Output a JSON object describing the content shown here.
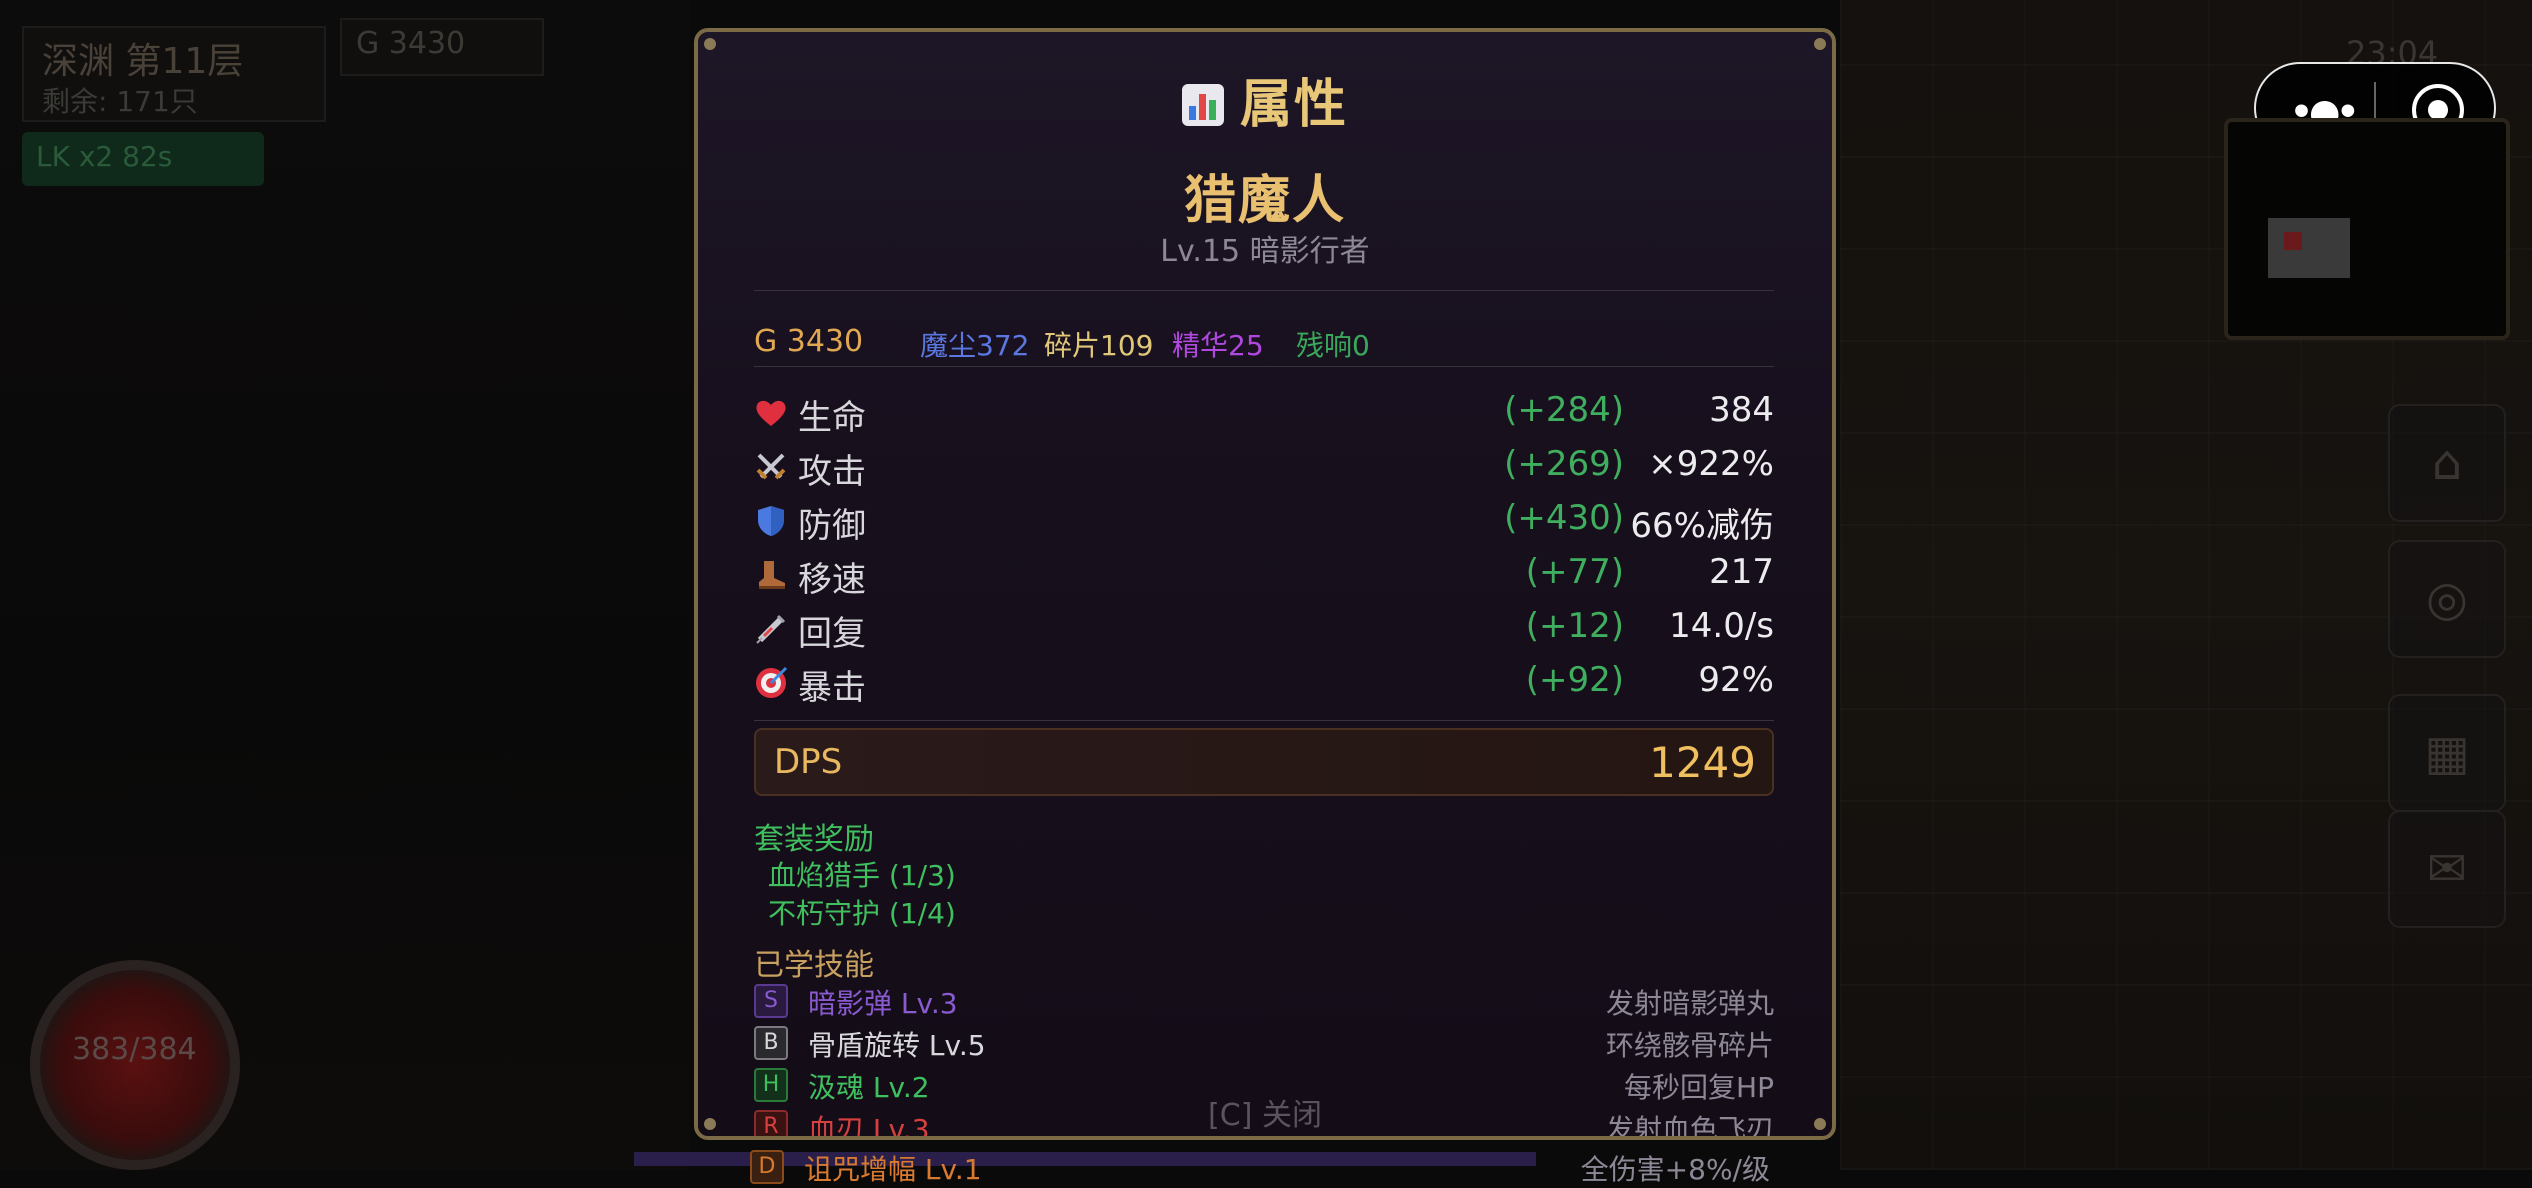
{
  "hud": {
    "floor": "深渊 第11层",
    "remaining": "剩余: 171只",
    "gold": "G 3430",
    "buff": "LK x2 82s",
    "hp_orb": "383/384",
    "clock": "23:04"
  },
  "miniprogram": {
    "menu_icon": "more-dots-icon",
    "close_icon": "target-close-icon"
  },
  "side_buttons": [
    "home-icon",
    "globe-icon",
    "shop-icon",
    "mail-icon"
  ],
  "panel": {
    "title": "属性",
    "title_icon": "bar-chart-icon",
    "character_name": "猎魔人",
    "character_sub": "Lv.15 暗影行者",
    "currencies": [
      {
        "label": "G 3430",
        "color": "#e0a850"
      },
      {
        "label": "魔尘372",
        "color": "#5a78e0"
      },
      {
        "label": "碎片109",
        "color": "#e0c878"
      },
      {
        "label": "精华25",
        "color": "#b048e0"
      },
      {
        "label": "残响0",
        "color": "#3aa85a"
      }
    ],
    "stats": [
      {
        "icon": "heart-icon",
        "label": "生命",
        "bonus": "(+284)",
        "value": "384"
      },
      {
        "icon": "crossed-swords-icon",
        "label": "攻击",
        "bonus": "(+269)",
        "value": "×922%"
      },
      {
        "icon": "shield-icon",
        "label": "防御",
        "bonus": "(+430)",
        "value": "66%减伤"
      },
      {
        "icon": "boot-icon",
        "label": "移速",
        "bonus": "(+77)",
        "value": "217"
      },
      {
        "icon": "syringe-icon",
        "label": "回复",
        "bonus": "(+12)",
        "value": "14.0/s"
      },
      {
        "icon": "target-icon",
        "label": "暴击",
        "bonus": "(+92)",
        "value": "92%"
      }
    ],
    "dps_label": "DPS",
    "dps_value": "1249",
    "set_title": "套装奖励",
    "sets": [
      "血焰猎手 (1/3)",
      "不朽守护 (1/4)"
    ],
    "skills_title": "已学技能",
    "skills": [
      {
        "badge": "S",
        "name": "暗影弹 Lv.3",
        "desc": "发射暗影弹丸",
        "color": "#8a5ad0"
      },
      {
        "badge": "B",
        "name": "骨盾旋转 Lv.5",
        "desc": "环绕骸骨碎片",
        "color": "#d8d8dc"
      },
      {
        "badge": "H",
        "name": "汲魂 Lv.2",
        "desc": "每秒回复HP",
        "color": "#3fbf5e"
      },
      {
        "badge": "R",
        "name": "血刃 Lv.3",
        "desc": "发射血色飞刃",
        "color": "#d84040"
      },
      {
        "badge": "D",
        "name": "诅咒增幅 Lv.1",
        "desc": "全伤害+8%/级",
        "color": "#d87a30"
      }
    ],
    "close_hint": "[C] 关闭"
  }
}
